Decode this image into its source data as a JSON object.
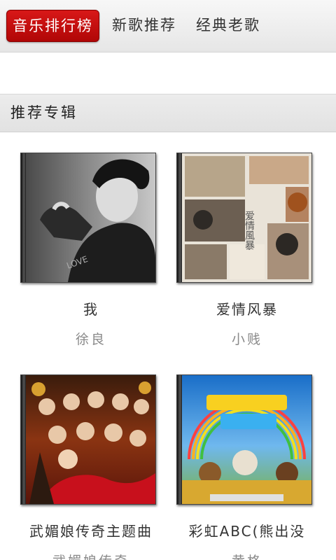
{
  "tabs": [
    {
      "label": "音乐排行榜",
      "active": true
    },
    {
      "label": "新歌推荐",
      "active": false
    },
    {
      "label": "经典老歌",
      "active": false
    }
  ],
  "section": {
    "title": "推荐专辑"
  },
  "albums": [
    {
      "title": "我",
      "artist": "徐良"
    },
    {
      "title": "爱情风暴",
      "artist": "小贱"
    },
    {
      "title": "武媚娘传奇主题曲",
      "artist": "武媚娘传奇"
    },
    {
      "title": "彩虹ABC(熊出没",
      "artist": "黄格"
    }
  ],
  "colors": {
    "active_tab": "#c40e0e",
    "artist_text": "#8a8a8a"
  }
}
